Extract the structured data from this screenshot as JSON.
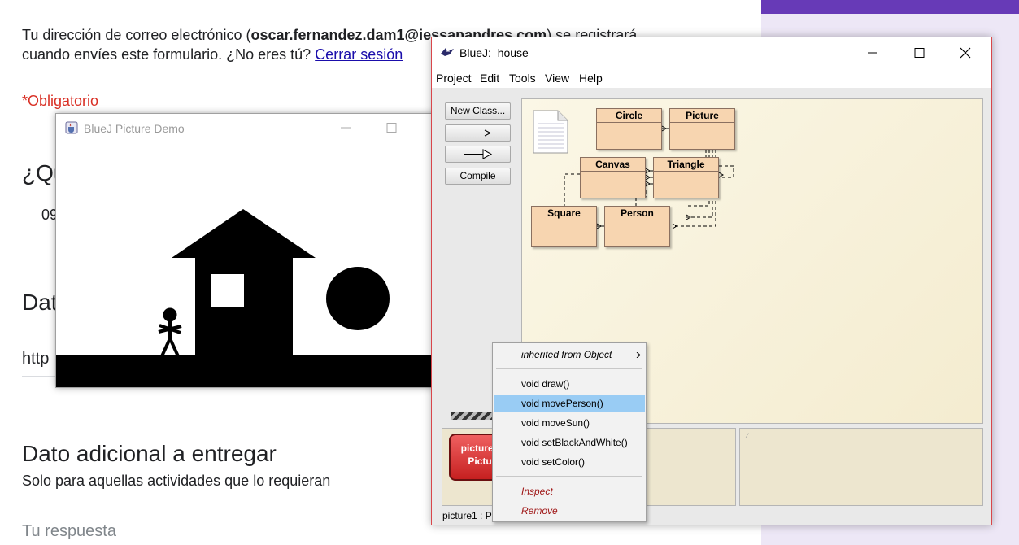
{
  "form": {
    "email_prefix": "Tu dirección de correo electrónico (",
    "email": "oscar.fernandez.dam1@iessanandres.com",
    "email_suffix": ") se registrará",
    "line2_text": "cuando envíes este formulario. ¿No eres tú? ",
    "signout_link": "Cerrar sesión",
    "required_note": "*Obligatorio",
    "q1_title_partial": "¿Qu",
    "q1_answer_partial": "09",
    "q2_title_partial": "Dat",
    "q2_answer_partial": "http",
    "q3_title": "Dato adicional a entregar",
    "q3_description": "Solo para aquellas actividades que lo requieran",
    "q3_placeholder": "Tu respuesta",
    "colors": {
      "accent": "#673ab7",
      "panel": "#ede7f6",
      "required": "#d93025",
      "link": "#1a0dab"
    }
  },
  "demo_window": {
    "title": "BlueJ Picture Demo",
    "app_icon": "java-cup-icon",
    "scene": {
      "shapes": [
        "house-wall",
        "roof-triangle",
        "window-square",
        "sun-circle",
        "ground-rectangle",
        "stick-person"
      ],
      "color": "#000000"
    }
  },
  "bluej": {
    "title": "BlueJ:  house",
    "app_icon": "bluej-bird-icon",
    "menu": [
      "Project",
      "Edit",
      "Tools",
      "View",
      "Help"
    ],
    "toolbar": {
      "new_class": "New Class...",
      "dashed_arrow": "- - ->",
      "solid_arrow": "——▷",
      "compile": "Compile"
    },
    "classes": [
      "Circle",
      "Picture",
      "Canvas",
      "Triangle",
      "Square",
      "Person"
    ],
    "object": {
      "name": "picture1",
      "type": "Pictu"
    },
    "status": "picture1 : P",
    "colors": {
      "class_fill": "#f7d5b0",
      "object_fill": "#d94040",
      "diagram_bg": "#f6f0da"
    }
  },
  "popup": {
    "inherited": "inherited from Object",
    "methods": [
      "void draw()",
      "void movePerson()",
      "void moveSun()",
      "void setBlackAndWhite()",
      "void setColor()"
    ],
    "selected": "void movePerson()",
    "inspect": "Inspect",
    "remove": "Remove",
    "selection_color": "#99ccf4"
  }
}
